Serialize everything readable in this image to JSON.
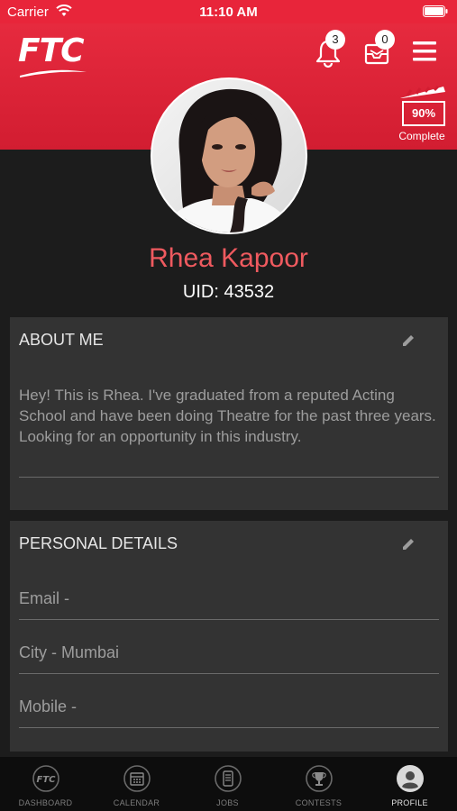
{
  "status_bar": {
    "carrier": "Carrier",
    "time": "11:10 AM"
  },
  "header": {
    "logo_text": "FTC",
    "notifications_count": "3",
    "messages_count": "0",
    "profile_completion": "90%",
    "profile_completion_label": "Complete"
  },
  "profile": {
    "name": "Rhea Kapoor",
    "uid": "UID: 43532"
  },
  "about": {
    "title": "ABOUT ME",
    "text": "Hey! This is Rhea. I've graduated from a reputed Acting School and have been doing Theatre for the past three years. Looking for an opportunity in this industry."
  },
  "personal_details": {
    "title": "PERSONAL DETAILS",
    "email": "Email -",
    "city": "City - Mumbai",
    "mobile": "Mobile -"
  },
  "tabs": [
    {
      "label": "DASHBOARD",
      "icon": "ftc-logo-icon"
    },
    {
      "label": "CALENDAR",
      "icon": "calendar-icon"
    },
    {
      "label": "JOBS",
      "icon": "jobs-icon"
    },
    {
      "label": "CONTESTS",
      "icon": "trophy-icon"
    },
    {
      "label": "PROFILE",
      "icon": "user-icon"
    }
  ],
  "colors": {
    "brand_red": "#e8253a",
    "name_color": "#ef5a5f",
    "card_bg": "#333333",
    "background": "#1c1c1c"
  }
}
